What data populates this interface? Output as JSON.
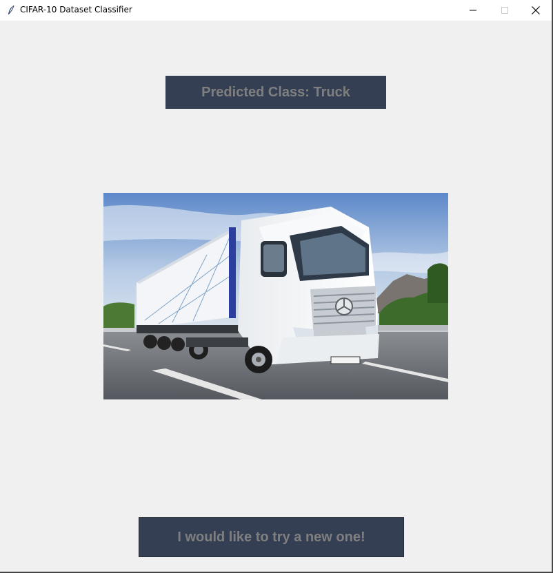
{
  "window": {
    "title": "CIFAR-10 Dataset Classifier",
    "icon": "feather-icon",
    "controls": [
      "minimize-icon",
      "maximize-icon",
      "close-icon"
    ]
  },
  "prediction": {
    "text": "Predicted Class: Truck"
  },
  "image": {
    "subject": "white semi-truck with trailer on highway"
  },
  "actions": {
    "try_again_label": "I would like to try a new one!"
  },
  "colors": {
    "label_background": "#353f54",
    "label_text": "#7f7f7f",
    "window_background": "#f0f0f0"
  }
}
